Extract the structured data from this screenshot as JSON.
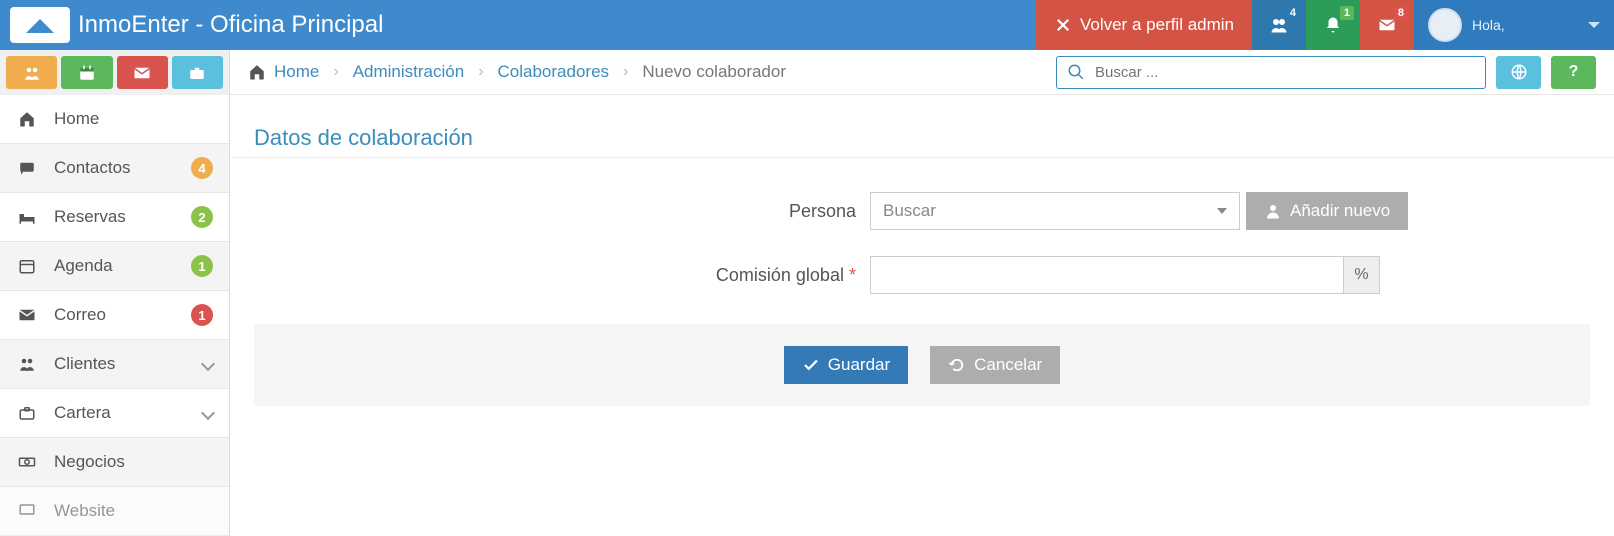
{
  "header": {
    "app_title": "InmoEnter - Oficina Principal",
    "back_label": "Volver a perfil admin",
    "greeting": "Hola,",
    "badges": {
      "group": "4",
      "bell": "1",
      "mail": "8"
    }
  },
  "search": {
    "placeholder": "Buscar ..."
  },
  "breadcrumb": {
    "home": "Home",
    "admin": "Administración",
    "collab": "Colaboradores",
    "current": "Nuevo colaborador"
  },
  "sidebar": {
    "items": [
      {
        "label": "Home"
      },
      {
        "label": "Contactos",
        "badge": "4",
        "badge_color": "orange"
      },
      {
        "label": "Reservas",
        "badge": "2",
        "badge_color": "green"
      },
      {
        "label": "Agenda",
        "badge": "1",
        "badge_color": "green"
      },
      {
        "label": "Correo",
        "badge": "1",
        "badge_color": "red"
      },
      {
        "label": "Clientes",
        "chevron": true
      },
      {
        "label": "Cartera",
        "chevron": true
      },
      {
        "label": "Negocios"
      },
      {
        "label": "Website"
      }
    ]
  },
  "form": {
    "section_title": "Datos de colaboración",
    "persona_label": "Persona",
    "persona_placeholder": "Buscar",
    "add_new_label": "Añadir nuevo",
    "comision_label": "Comisión global",
    "percent_symbol": "%",
    "save_label": "Guardar",
    "cancel_label": "Cancelar"
  }
}
